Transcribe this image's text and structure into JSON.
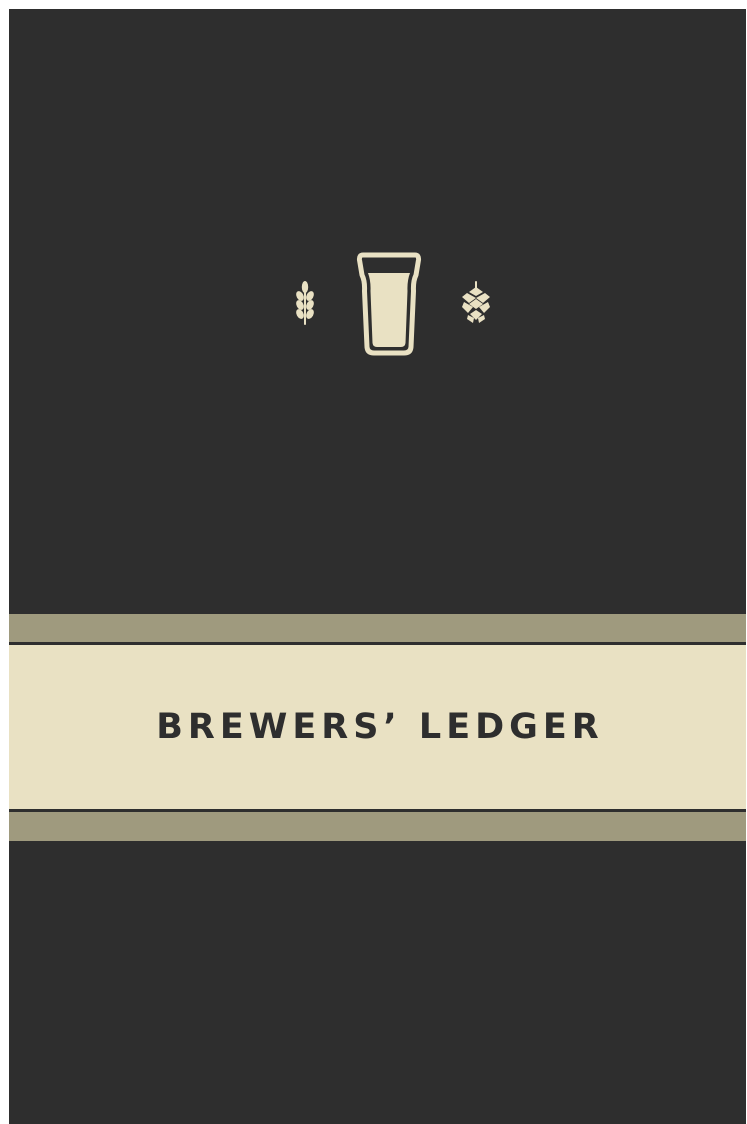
{
  "cover": {
    "title": "BREWERS’ LEDGER",
    "icons": [
      "wheat-icon",
      "pint-glass-icon",
      "hop-icon"
    ]
  },
  "colors": {
    "background": "#2e2e2e",
    "cream": "#e9e1c3",
    "band": "#9f9a7e",
    "text": "#2e2e2e"
  }
}
